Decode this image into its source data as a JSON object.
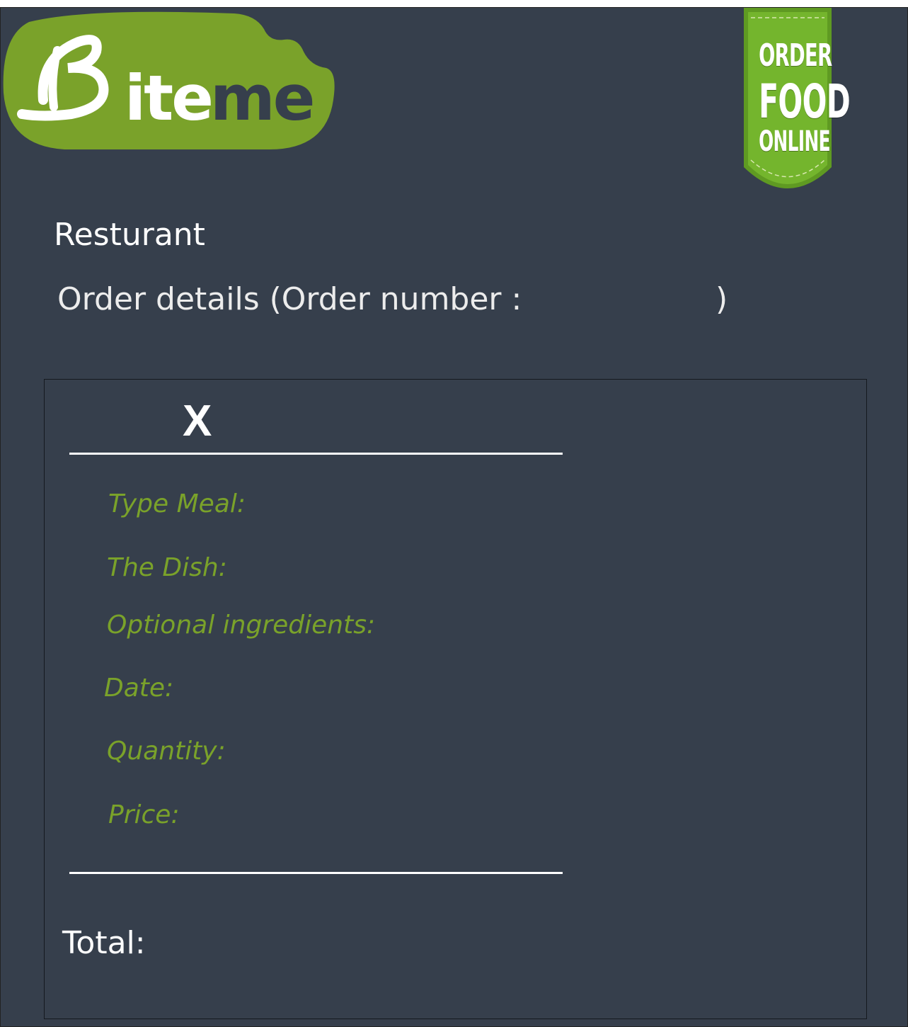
{
  "header": {
    "logo": {
      "text": "Biteme",
      "accent": "#7aa22a",
      "text_dark": "#363f4c"
    },
    "badge": {
      "line1": "ORDER",
      "line2": "FOOD",
      "line3": "ONLINE",
      "color": "#6fb02a"
    }
  },
  "restaurant_label": "Resturant",
  "order": {
    "title": "Order details (Order number :",
    "number": "",
    "close_paren": ")"
  },
  "item_panel": {
    "remove_label": "X",
    "fields": [
      {
        "label": "Type Meal:"
      },
      {
        "label": "The Dish:"
      },
      {
        "label": "Optional ingredients:"
      },
      {
        "label": "Date:"
      },
      {
        "label": "Quantity:"
      },
      {
        "label": "Price:"
      }
    ],
    "total_label": "Total:"
  },
  "colors": {
    "background": "#363f4c",
    "field_label": "#7aa22a",
    "text": "#ffffff"
  }
}
